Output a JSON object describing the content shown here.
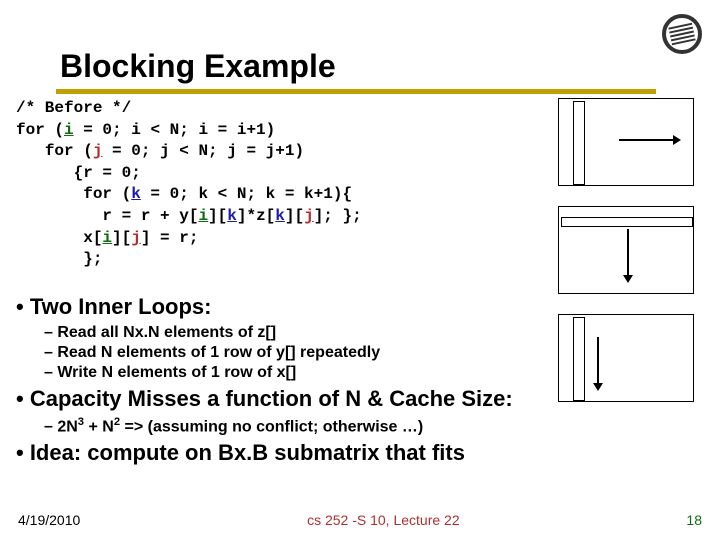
{
  "title": "Blocking Example",
  "code_lines": [
    {
      "indent": 0,
      "segments": [
        {
          "t": "/* Before */"
        }
      ]
    },
    {
      "indent": 0,
      "segments": [
        {
          "t": "for ("
        },
        {
          "t": "i",
          "cls": "v-i"
        },
        {
          "t": " = 0; i < N; i = i+1)"
        }
      ]
    },
    {
      "indent": 1,
      "segments": [
        {
          "t": "for ("
        },
        {
          "t": "j",
          "cls": "v-j"
        },
        {
          "t": " = 0; j < N; j = j+1)"
        }
      ]
    },
    {
      "indent": 2,
      "segments": [
        {
          "t": "{r = 0;"
        }
      ]
    },
    {
      "indent": 2,
      "segments": [
        {
          "t": " for ("
        },
        {
          "t": "k",
          "cls": "v-k"
        },
        {
          "t": " = 0; k < N; k = k+1){"
        }
      ]
    },
    {
      "indent": 3,
      "segments": [
        {
          "t": "r = r + y["
        },
        {
          "t": "i",
          "cls": "v-i"
        },
        {
          "t": "]["
        },
        {
          "t": "k",
          "cls": "v-k"
        },
        {
          "t": "]*z["
        },
        {
          "t": "k",
          "cls": "v-k"
        },
        {
          "t": "]["
        },
        {
          "t": "j",
          "cls": "v-j"
        },
        {
          "t": "]; };"
        }
      ]
    },
    {
      "indent": 2,
      "segments": [
        {
          "t": " x["
        },
        {
          "t": "i",
          "cls": "v-i"
        },
        {
          "t": "]["
        },
        {
          "t": "j",
          "cls": "v-j"
        },
        {
          "t": "] = r;"
        }
      ]
    },
    {
      "indent": 2,
      "segments": [
        {
          "t": " };"
        }
      ]
    }
  ],
  "bullets": {
    "b1a": "•  Two Inner Loops:",
    "sub1": "Read all Nx.N elements of z[]",
    "sub2": "Read N elements of 1 row of y[] repeatedly",
    "sub3": "Write N elements of 1 row of x[]",
    "b1b": "•  Capacity Misses a function of N & Cache Size:",
    "sub4_prefix": "2N",
    "sub4_exp": "3",
    "sub4_mid": " + N",
    "sub4_exp2": "2",
    "sub4_suffix": " => (assuming no conflict; otherwise …)",
    "b1c": "•  Idea: compute on Bx.B submatrix that fits"
  },
  "footer": {
    "date": "4/19/2010",
    "mid": "cs 252 -S 10, Lecture 22",
    "num": "18"
  },
  "chart_data": [
    {
      "type": "diagram",
      "desc": "matrix-traversal",
      "highlight": "column",
      "arrow": "right",
      "grid": {
        "rows": null,
        "cols": null
      }
    },
    {
      "type": "diagram",
      "desc": "matrix-traversal",
      "highlight": "row",
      "arrow": "down",
      "grid": {
        "rows": null,
        "cols": null
      }
    },
    {
      "type": "diagram",
      "desc": "matrix-traversal",
      "highlight": "column",
      "arrow": "down",
      "grid": {
        "rows": null,
        "cols": null
      }
    }
  ]
}
